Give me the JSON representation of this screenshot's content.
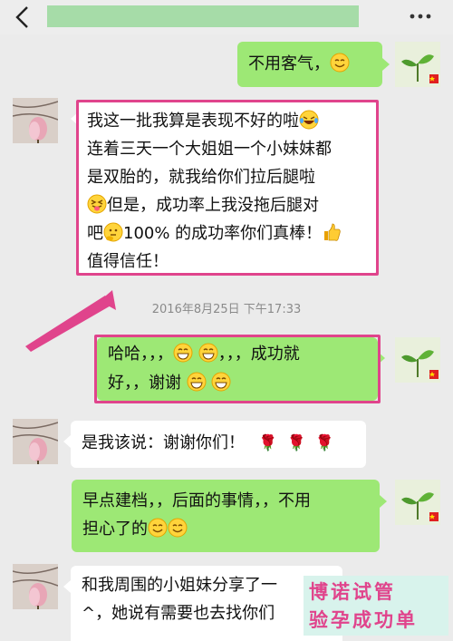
{
  "header": {
    "back_icon": "chevron-left-icon",
    "more_icon": "more-dots-icon"
  },
  "messages": [
    {
      "side": "out",
      "text": "不用客气，"
    },
    {
      "side": "in",
      "line1": "我这一批我算是表现不好的啦",
      "line2": "连着三天一个大姐姐一个小妹妹都",
      "line3": "是双胎的，就我给你们拉后腿啦",
      "line4": "但是，成功率上我没拖后腿对",
      "line5a": "吧",
      "line5b": "100% 的成功率你们真棒！",
      "line6": "值得信任！"
    },
    {
      "side": "out",
      "line1a": "哈哈，，，",
      "line1b": "，，，成功就",
      "line2a": "好，，谢谢"
    },
    {
      "side": "in",
      "text": "是我该说：谢谢你们！"
    },
    {
      "side": "out",
      "line1": "早点建档，，后面的事情，，不用",
      "line2": "担心了的"
    },
    {
      "side": "in",
      "line1": "和我周围的小姐妹分享了一",
      "line2": "^，她说有需要也去找你们"
    }
  ],
  "timestamp": "2016年8月25日 下午17:33",
  "watermark": {
    "line1": "博诺试管",
    "line2": "验孕成功单"
  },
  "colors": {
    "incoming_bubble": "#ffffff",
    "outgoing_bubble": "#9de875",
    "highlight": "#e0448c",
    "background": "#ebebeb"
  }
}
